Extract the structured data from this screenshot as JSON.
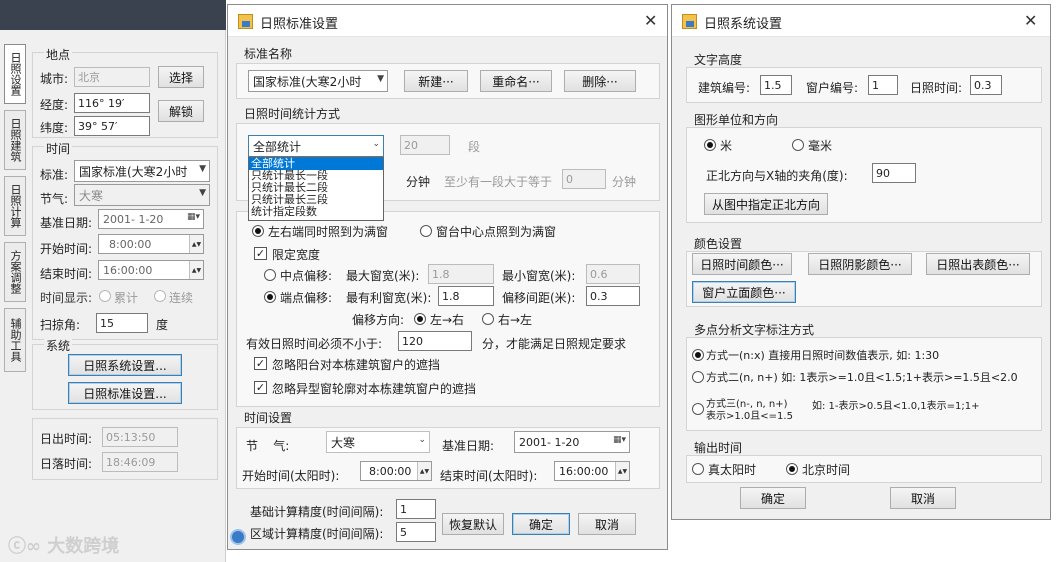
{
  "sidebar_tabs": [
    "日照设置",
    "日照建筑",
    "日照计算",
    "方案调整",
    "辅助工具"
  ],
  "left": {
    "loc_group": "地点",
    "city_label": "城市:",
    "city_value": "北京",
    "select_btn": "选择",
    "lon_label": "经度:",
    "lon_value": "116° 19′",
    "unlock_btn": "解锁",
    "lat_label": "纬度:",
    "lat_value": "39° 57′",
    "time_group": "时间",
    "standard_label": "标准:",
    "standard_value": "国家标准(大寒2小时",
    "solar_label": "节气:",
    "solar_value": "大寒",
    "base_date_label": "基准日期:",
    "base_date_value": "2001- 1-20",
    "start_label": "开始时间:",
    "start_value": "8:00:00",
    "end_label": "结束时间:",
    "end_value": "16:00:00",
    "display_label": "时间显示:",
    "display_opt1": "累计",
    "display_opt2": "连续",
    "scan_label": "扫掠角:",
    "scan_value": "15",
    "scan_unit": "度",
    "sys_group": "系统",
    "sys_btn": "日照系统设置...",
    "std_btn": "日照标准设置...",
    "sunrise_label": "日出时间:",
    "sunrise_value": "05:13:50",
    "sunset_label": "日落时间:",
    "sunset_value": "18:46:09",
    "watermark": "大数跨境"
  },
  "std_dialog": {
    "title": "日照标准设置",
    "close": "✕",
    "name_group": "标准名称",
    "name_value": "国家标准(大寒2小时",
    "new_btn": "新建···",
    "rename_btn": "重命名···",
    "delete_btn": "删除···",
    "method_group": "日照时间统计方式",
    "method_value": "全部统计",
    "dropdown_options": [
      "全部统计",
      "只统计最长一段",
      "只统计最长二段",
      "只统计最长三段",
      "统计指定段数"
    ],
    "seg_value": "20",
    "seg_unit": "段",
    "minute_label": "分钟",
    "atleast_label": "至少有一段大于等于",
    "atleast_value": "0",
    "atleast_unit": "分钟",
    "window_opt1": "左右端同时照到为满窗",
    "window_opt2": "窗台中心点照到为满窗",
    "limit_width": "限定宽度",
    "center_offset": "中点偏移:",
    "max_width_label": "最大窗宽(米):",
    "max_width_value": "1.8",
    "min_width_label": "最小窗宽(米):",
    "min_width_value": "0.6",
    "end_offset": "端点偏移:",
    "best_width_label": "最有利窗宽(米):",
    "best_width_value": "1.8",
    "offset_gap_label": "偏移间距(米):",
    "offset_gap_value": "0.3",
    "direction_label": "偏移方向:",
    "dir_opt1": "左→右",
    "dir_opt2": "右→左",
    "valid_label": "有效日照时间必须不小于:",
    "valid_value": "120",
    "valid_suffix": "分，才能满足日照规定要求",
    "ignore1": "忽略阳台对本栋建筑窗户的遮挡",
    "ignore2": "忽略异型窗轮廓对本栋建筑窗户的遮挡",
    "time_group": "时间设置",
    "solar_label": "节    气:",
    "solar_value": "大寒",
    "base_date_label": "基准日期:",
    "base_date_value": "2001- 1-20",
    "start_label": "开始时间(太阳时):",
    "start_value": "8:00:00",
    "end_label": "结束时间(太阳时):",
    "end_value": "16:00:00",
    "base_prec_label": "基础计算精度(时间间隔):",
    "base_prec_value": "1",
    "area_prec_label": "区域计算精度(时间间隔):",
    "area_prec_value": "5",
    "restore_btn": "恢复默认",
    "ok_btn": "确定",
    "cancel_btn": "取消"
  },
  "sys_dialog": {
    "title": "日照系统设置",
    "close": "✕",
    "text_group": "文字高度",
    "bld_label": "建筑编号:",
    "bld_value": "1.5",
    "win_label": "窗户编号:",
    "win_value": "1",
    "sun_label": "日照时间:",
    "sun_value": "0.3",
    "unit_group": "图形单位和方向",
    "unit_m": "米",
    "unit_mm": "毫米",
    "north_label": "正北方向与X轴的夹角(度):",
    "north_value": "90",
    "north_btn": "从图中指定正北方向",
    "color_group": "颜色设置",
    "color_btn1": "日照时间颜色···",
    "color_btn2": "日照阴影颜色···",
    "color_btn3": "日照出表颜色···",
    "color_btn4": "窗户立面颜色···",
    "multi_group": "多点分析文字标注方式",
    "mode1": "方式一(n:x) 直接用日照时间数值表示, 如: 1:30",
    "mode2": "方式二(n, n+) 如: 1表示>=1.0且<1.5;1+表示>=1.5且<2.0",
    "mode3a": "方式三(n-, n, n+)",
    "mode3b": "表示>1.0且<=1.5",
    "mode3c": "如: 1-表示>0.5且<1.0,1表示=1;1+",
    "output_group": "输出时间",
    "out_opt1": "真太阳时",
    "out_opt2": "北京时间",
    "ok_btn": "确定",
    "cancel_btn": "取消"
  }
}
